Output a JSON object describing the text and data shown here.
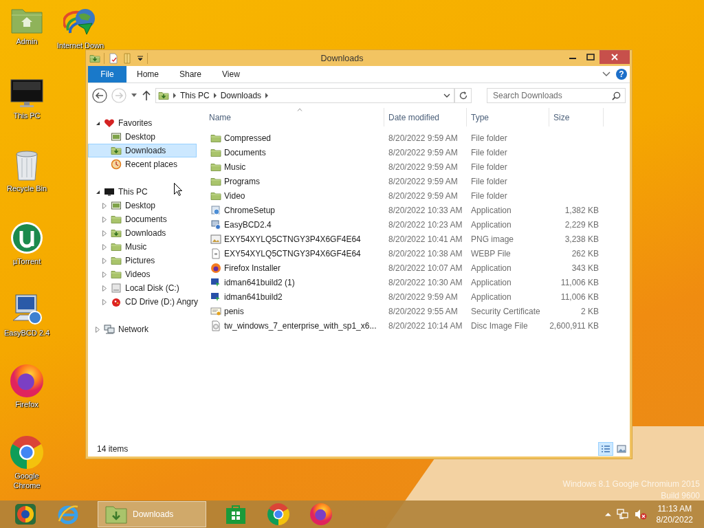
{
  "desktop_icons": [
    {
      "label": "Admin",
      "kind": "home-folder"
    },
    {
      "label": "This PC",
      "kind": "computer"
    },
    {
      "label": "Recycle Bin",
      "kind": "bin"
    },
    {
      "label": "µTorrent",
      "kind": "torrent"
    },
    {
      "label": "EasyBCD 2.4",
      "kind": "easybcd"
    },
    {
      "label": "Firefox",
      "kind": "firefox"
    },
    {
      "label": "Google Chrome",
      "kind": "chrome"
    },
    {
      "label": "Internet Down",
      "kind": "downloader"
    }
  ],
  "window": {
    "title": "Downloads",
    "ribbon_tabs": [
      {
        "label": "File",
        "kind": "file-menu"
      },
      {
        "label": "Home",
        "kind": "tab"
      },
      {
        "label": "Share",
        "kind": "tab"
      },
      {
        "label": "View",
        "kind": "tab"
      }
    ],
    "help": "?",
    "breadcrumb": [
      "This PC",
      "Downloads"
    ],
    "search": {
      "placeholder": "Search Downloads"
    },
    "nav_tree": [
      {
        "label": "Favorites",
        "kind": "favorites",
        "expanded": true,
        "selected": false,
        "children": [
          {
            "label": "Desktop",
            "kind": "desktop",
            "selected": false
          },
          {
            "label": "Downloads",
            "kind": "downloads",
            "selected": true
          },
          {
            "label": "Recent places",
            "kind": "recent",
            "selected": false
          }
        ]
      },
      {
        "label": "This PC",
        "kind": "computer",
        "expanded": true,
        "selected": false,
        "children": [
          {
            "label": "Desktop",
            "kind": "desktop",
            "expanded": false,
            "selected": false
          },
          {
            "label": "Documents",
            "kind": "folder",
            "expanded": false,
            "selected": false
          },
          {
            "label": "Downloads",
            "kind": "downloads",
            "expanded": false,
            "selected": false
          },
          {
            "label": "Music",
            "kind": "folder",
            "expanded": false,
            "selected": false
          },
          {
            "label": "Pictures",
            "kind": "folder",
            "expanded": false,
            "selected": false
          },
          {
            "label": "Videos",
            "kind": "folder",
            "expanded": false,
            "selected": false
          },
          {
            "label": "Local Disk (C:)",
            "kind": "disk",
            "expanded": false,
            "selected": false
          },
          {
            "label": "CD Drive (D:) Angry",
            "kind": "cd",
            "expanded": false,
            "selected": false
          }
        ]
      },
      {
        "label": "Network",
        "kind": "network",
        "expanded": false,
        "selected": false
      }
    ],
    "columns": [
      {
        "label": "Name",
        "sorted": true
      },
      {
        "label": "Date modified",
        "sorted": false
      },
      {
        "label": "Type",
        "sorted": false
      },
      {
        "label": "Size",
        "sorted": false
      }
    ],
    "files": [
      {
        "name": "Compressed",
        "kind": "folder",
        "date": "8/20/2022 9:59 AM",
        "type": "File folder"
      },
      {
        "name": "Documents",
        "kind": "folder",
        "date": "8/20/2022 9:59 AM",
        "type": "File folder"
      },
      {
        "name": "Music",
        "kind": "folder",
        "date": "8/20/2022 9:59 AM",
        "type": "File folder"
      },
      {
        "name": "Programs",
        "kind": "folder",
        "date": "8/20/2022 9:59 AM",
        "type": "File folder"
      },
      {
        "name": "Video",
        "kind": "folder",
        "date": "8/20/2022 9:59 AM",
        "type": "File folder"
      },
      {
        "name": "ChromeSetup",
        "kind": "installer",
        "date": "8/20/2022 10:33 AM",
        "type": "Application",
        "size": "1,382 KB"
      },
      {
        "name": "EasyBCD2.4",
        "kind": "setup",
        "date": "8/20/2022 10:23 AM",
        "type": "Application",
        "size": "2,229 KB"
      },
      {
        "name": "EXY54XYLQ5CTNGY3P4X6GF4E64",
        "kind": "image",
        "date": "8/20/2022 10:41 AM",
        "type": "PNG image",
        "size": "3,238 KB"
      },
      {
        "name": "EXY54XYLQ5CTNGY3P4X6GF4E64",
        "kind": "file",
        "date": "8/20/2022 10:38 AM",
        "type": "WEBP File",
        "size": "262 KB"
      },
      {
        "name": "Firefox Installer",
        "kind": "firefox",
        "date": "8/20/2022 10:07 AM",
        "type": "Application",
        "size": "343 KB"
      },
      {
        "name": "idman641build2 (1)",
        "kind": "app",
        "date": "8/20/2022 10:30 AM",
        "type": "Application",
        "size": "11,006 KB"
      },
      {
        "name": "idman641build2",
        "kind": "app",
        "date": "8/20/2022 9:59 AM",
        "type": "Application",
        "size": "11,006 KB"
      },
      {
        "name": "penis",
        "kind": "certificate",
        "date": "8/20/2022 9:55 AM",
        "type": "Security Certificate",
        "size": "2 KB"
      },
      {
        "name": "tw_windows_7_enterprise_with_sp1_x6...",
        "kind": "disc",
        "date": "8/20/2022 10:14 AM",
        "type": "Disc Image File",
        "size": "2,600,911 KB"
      }
    ],
    "status": "14 items",
    "views": [
      {
        "kind": "details",
        "selected": true
      },
      {
        "kind": "large-icons",
        "selected": false
      }
    ]
  },
  "os_watermark": [
    "Windows 8.1 Google Chromium 2015",
    "Build 9600"
  ],
  "taskbar": [
    {
      "kind": "ball",
      "selected": false
    },
    {
      "kind": "ie",
      "selected": false
    },
    {
      "kind": "explorer",
      "label": "Downloads",
      "selected": true
    },
    {
      "kind": "store",
      "selected": false
    },
    {
      "kind": "chrome",
      "selected": false
    },
    {
      "kind": "firefox",
      "selected": false
    }
  ],
  "tray": {
    "volume_muted": true,
    "time": "11:13 AM",
    "date": "8/20/2022"
  }
}
